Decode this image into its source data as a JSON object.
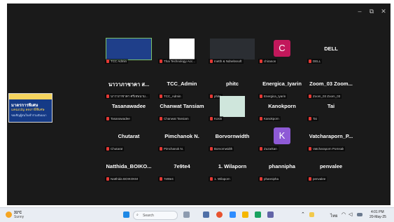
{
  "window": {
    "controls": {
      "minimize": "–",
      "maximize": "⧉",
      "close": "✕"
    }
  },
  "shared_screen": {
    "line1": "มาตรการพิเศษ",
    "line2": "แคมเปญ ลดภาษีพิเศษ",
    "line3": "ขอเชิญผู้สนใจเข้าร่วมสัมมนา"
  },
  "participants": [
    {
      "name": "",
      "label": "TCC Admin",
      "kind": "video",
      "active": true
    },
    {
      "name": "",
      "label": "Thai Technology Acc...",
      "kind": "logo"
    },
    {
      "name": "",
      "label": "Inetth & Ndnebssoft",
      "kind": "video"
    },
    {
      "name": "",
      "label": "chiranon",
      "kind": "avatar",
      "letter": "C",
      "color": "#c2185b"
    },
    {
      "name": "DELL",
      "label": "DELL",
      "kind": "name"
    },
    {
      "name": "นาวาภาชาคา ส...",
      "label": "นาวาภาชาคา ศรีเทพนาม...",
      "kind": "name"
    },
    {
      "name": "TCC_Admin",
      "label": "TCC_Admin",
      "kind": "name"
    },
    {
      "name": "phitc",
      "label": "phitc",
      "kind": "name"
    },
    {
      "name": "Energica_Iyarin",
      "label": "Energica_Iyarin",
      "kind": "name"
    },
    {
      "name": "Zoom_03 Zoom...",
      "label": "Zoom_03 Zoom_03",
      "kind": "name"
    },
    {
      "name": "Tasanawadee",
      "label": "Tasanawadee",
      "kind": "name"
    },
    {
      "name": "Chanwat Tansiam",
      "label": "Chanwat Tansiam",
      "kind": "name"
    },
    {
      "name": "",
      "label": "Kosin",
      "kind": "image"
    },
    {
      "name": "Kanokporn",
      "label": "Kanokporn",
      "kind": "name"
    },
    {
      "name": "Tai",
      "label": "Tai",
      "kind": "name"
    },
    {
      "name": "Chutarat",
      "label": "Chutarat",
      "kind": "name"
    },
    {
      "name": "Pimchanok N.",
      "label": "Pimchanok N.",
      "kind": "name"
    },
    {
      "name": "Borvornwidth",
      "label": "Borvornwidth",
      "kind": "name"
    },
    {
      "name": "",
      "label": "Zuzarkan",
      "kind": "avatar",
      "letter": "K",
      "color": "#8e5ad6"
    },
    {
      "name": "Vatcharaporn_P...",
      "label": "Vatcharaporn Pornsak",
      "kind": "name"
    },
    {
      "name": "Natthida_BOIKO...",
      "label": "Natthida BOIKOKM",
      "kind": "name"
    },
    {
      "name": "7e9te4",
      "label": "7e9te4",
      "kind": "name"
    },
    {
      "name": "1. Wilaporn",
      "label": "1. Wilaporn",
      "kind": "name"
    },
    {
      "name": "phannipha",
      "label": "phannipha",
      "kind": "name"
    },
    {
      "name": "penvalee",
      "label": "penvalee",
      "kind": "name"
    }
  ],
  "taskbar": {
    "weather_temp": "31°C",
    "weather_desc": "Sunny",
    "search_label": "Search",
    "time": "4:01 PM",
    "date": "20-May-25"
  }
}
